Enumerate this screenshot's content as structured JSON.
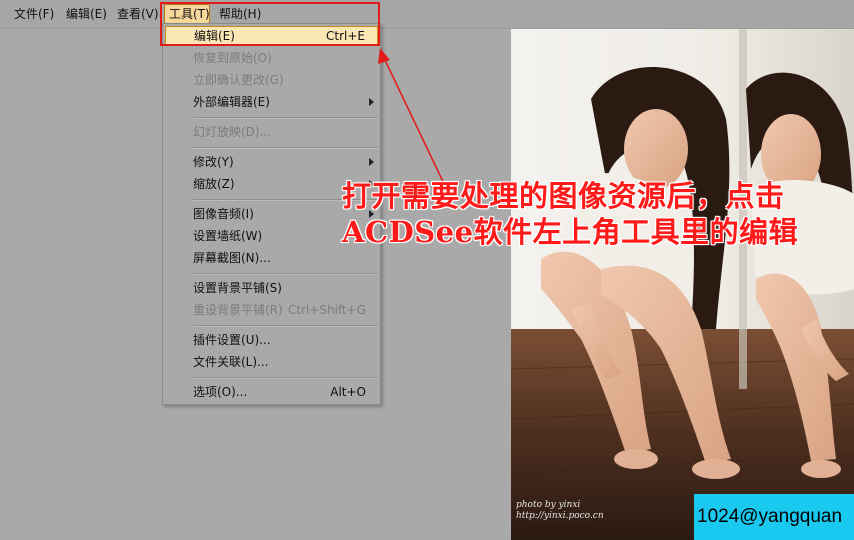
{
  "menubar": {
    "items": [
      {
        "label": "文件(F)"
      },
      {
        "label": "编辑(E)"
      },
      {
        "label": "查看(V)"
      },
      {
        "label": "工具(T)",
        "active": true
      },
      {
        "label": "帮助(H)"
      }
    ]
  },
  "tools_menu": {
    "items": [
      {
        "label": "编辑(E)",
        "shortcut": "Ctrl+E",
        "selected": true
      },
      {
        "label": "恢复到原始(O)",
        "disabled": true
      },
      {
        "label": "立即确认更改(G)",
        "disabled": true
      },
      {
        "label": "外部编辑器(E)",
        "submenu": true
      },
      {
        "label": "幻灯放映(D)...",
        "disabled": true
      },
      {
        "label": "修改(Y)",
        "submenu": true
      },
      {
        "label": "缩放(Z)",
        "submenu": true
      },
      {
        "label": "图像音频(I)",
        "submenu": true
      },
      {
        "label": "设置墙纸(W)"
      },
      {
        "label": "屏幕截图(N)..."
      },
      {
        "label": "设置背景平铺(S)"
      },
      {
        "label": "重设背景平铺(R)",
        "shortcut": "Ctrl+Shift+G",
        "disabled": true
      },
      {
        "label": "插件设置(U)..."
      },
      {
        "label": "文件关联(L)..."
      },
      {
        "label": "选项(O)...",
        "shortcut": "Alt+O"
      }
    ]
  },
  "annotation": {
    "line1": "打开需要处理的图像资源后，点击",
    "line2": "ACDSee软件左上角工具里的编辑",
    "color": "#ff1a1a"
  },
  "photo": {
    "credit_line1": "photo by yinxi",
    "credit_line2": "http://yinxi.poco.cn"
  },
  "watermark": {
    "text": "1024@yangquan",
    "background": "#19c9ef"
  },
  "colors": {
    "menubar_bg": "#a6a6a6",
    "menu_bg": "#a9a9a9",
    "highlight": "#fbe7b6",
    "highlight_border": "#c98a1a",
    "callout_red": "#e21b1b"
  }
}
